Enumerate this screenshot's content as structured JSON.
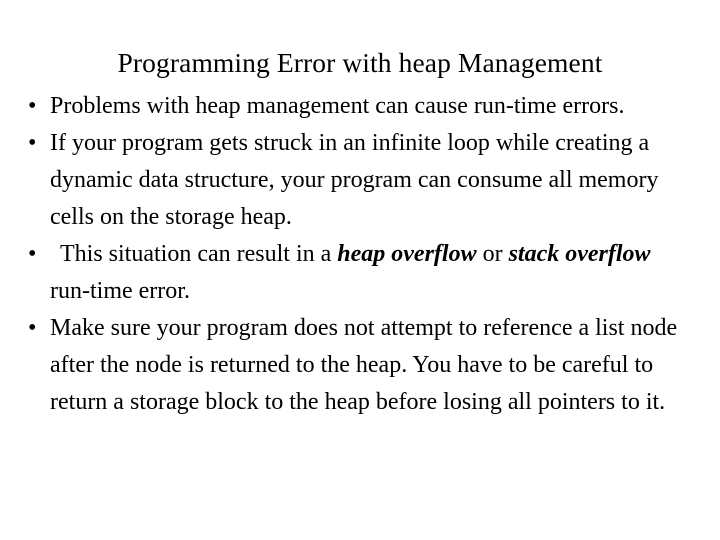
{
  "slide": {
    "title": "Programming Error with heap Management",
    "background_color": "#ffffff",
    "text_color": "#000000",
    "bullet_glyph": "•",
    "bullets": [
      {
        "id": "bullet-1",
        "leading_space": false,
        "segments": [
          {
            "text": "Problems with heap management can cause run-time errors.",
            "style": "normal"
          }
        ]
      },
      {
        "id": "bullet-2",
        "leading_space": false,
        "segments": [
          {
            "text": "If your program gets struck in an infinite loop while creating a dynamic data structure, your program can consume all memory cells on the storage heap.",
            "style": "normal"
          }
        ]
      },
      {
        "id": "bullet-3",
        "leading_space": true,
        "segments": [
          {
            "text": "This situation can result in a ",
            "style": "normal"
          },
          {
            "text": "heap overflow",
            "style": "bold-italic"
          },
          {
            "text": " or ",
            "style": "normal"
          },
          {
            "text": "stack overflow",
            "style": "bold-italic"
          },
          {
            "text": " run-time error.",
            "style": "normal"
          }
        ]
      },
      {
        "id": "bullet-4",
        "leading_space": false,
        "segments": [
          {
            "text": "Make sure your program does not attempt to reference a list node after the node is returned to the heap. You have to be careful to return a storage block to the heap before losing all pointers to it.",
            "style": "normal"
          }
        ]
      }
    ]
  }
}
